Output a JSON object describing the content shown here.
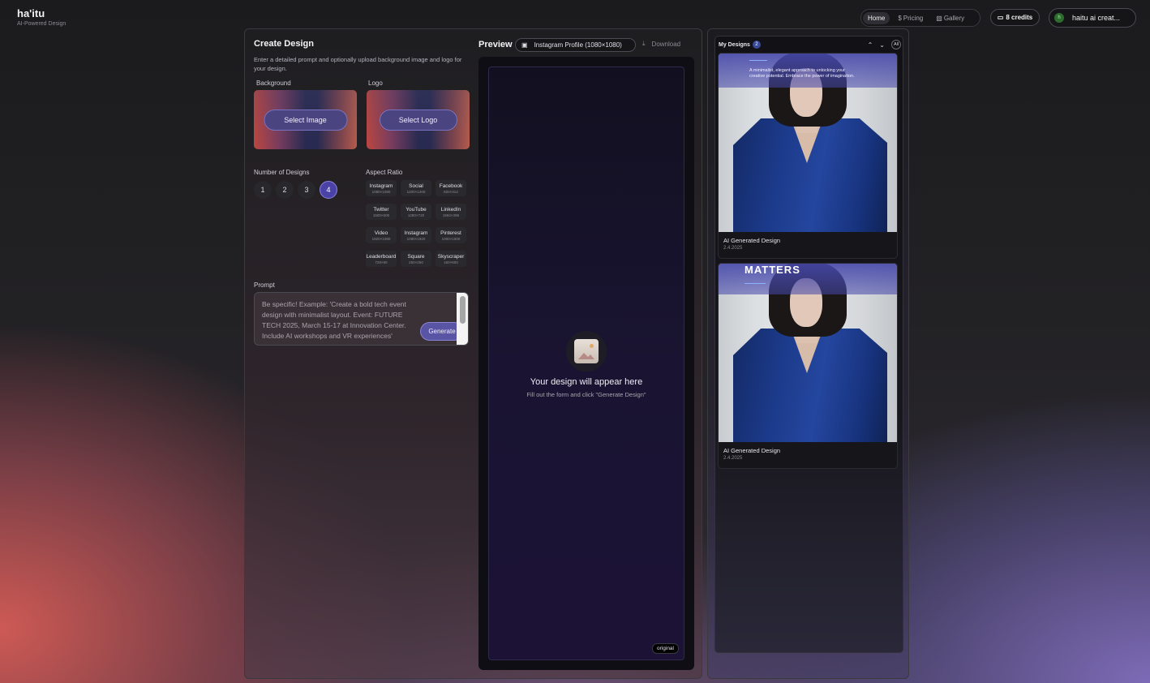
{
  "app": {
    "name": "ha'itu",
    "tagline": "AI-Powered Design"
  },
  "nav": {
    "home": "Home",
    "pricing": "Pricing",
    "gallery": "Gallery"
  },
  "account": {
    "credits": "8 credits",
    "user_name": "haitu ai creat...",
    "avatar_initial": "h"
  },
  "create": {
    "title": "Create Design",
    "description": "Enter a detailed prompt and optionally upload background image and logo for your design.",
    "background_label": "Background",
    "background_button": "Select Image",
    "logo_label": "Logo",
    "logo_button": "Select Logo",
    "num_designs_label": "Number of Designs",
    "num_options": [
      "1",
      "2",
      "3",
      "4"
    ],
    "num_selected": "4",
    "aspect_label": "Aspect Ratio",
    "aspect_ratios": [
      {
        "name": "Instagram",
        "size": "1080×1080"
      },
      {
        "name": "Social",
        "size": "1200×1200"
      },
      {
        "name": "Facebook",
        "size": "820×312"
      },
      {
        "name": "Twitter",
        "size": "1500×500"
      },
      {
        "name": "YouTube",
        "size": "1280×720"
      },
      {
        "name": "LinkedIn",
        "size": "1584×396"
      },
      {
        "name": "Video",
        "size": "1920×1080"
      },
      {
        "name": "Instagram",
        "size": "1080×1920"
      },
      {
        "name": "Pinterest",
        "size": "1000×1500"
      },
      {
        "name": "Leaderboard",
        "size": "728×90"
      },
      {
        "name": "Square",
        "size": "250×250"
      },
      {
        "name": "Skyscraper",
        "size": "160×600"
      }
    ],
    "prompt_label": "Prompt",
    "prompt_placeholder": "Be specific! Example: 'Create a bold tech event design with minimalist layout. Event: FUTURE TECH 2025, March 15-17 at Innovation Center. Include AI workshops and VR experiences'",
    "generate_button": "Generate"
  },
  "preview": {
    "title": "Preview",
    "format": "Instagram Profile (1080×1080)",
    "download": "Download",
    "placeholder_title": "Your design will appear here",
    "placeholder_sub": "Fill out the form and click \"Generate Design\"",
    "badge": "original"
  },
  "designs": {
    "title": "My Designs",
    "count": "2",
    "all_label": "All",
    "items": [
      {
        "title": "AI Generated Design",
        "date": "2.4.2025",
        "overlay_text": "A minimalist, elegant approach to unlocking your creative potential. Embrace the power of imagination."
      },
      {
        "title": "AI Generated Design",
        "date": "2.4.2025",
        "headline": "MATTERS"
      }
    ]
  },
  "colors": {
    "accent": "#4b42a8",
    "button": "#4a4480",
    "count_badge": "#3a4a9a"
  }
}
